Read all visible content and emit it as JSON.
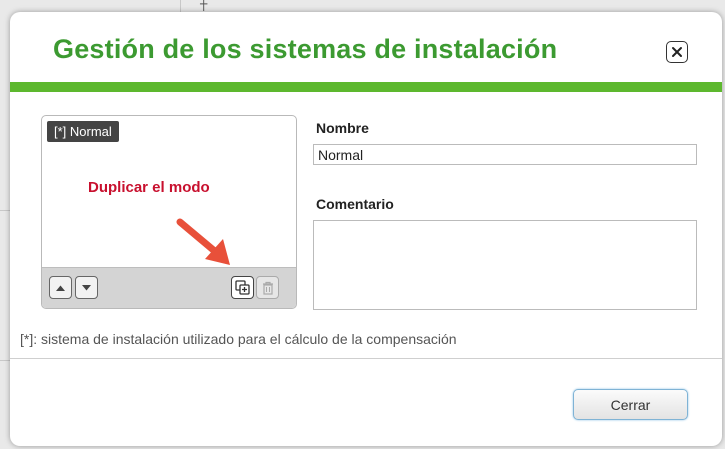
{
  "dialog": {
    "title": "Gestión de los sistemas de instalación",
    "close_icon": "close-icon",
    "accent_color": "#5db82e",
    "title_color": "#3c9a31"
  },
  "list": {
    "selected_item": "[*] Normal",
    "annotation": "Duplicar el modo",
    "annotation_color": "#c8102e",
    "toolbar": {
      "up_icon": "arrow-up-icon",
      "down_icon": "arrow-down-icon",
      "duplicate_icon": "duplicate-icon",
      "delete_icon": "trash-icon"
    }
  },
  "form": {
    "name_label": "Nombre",
    "name_value": "Normal",
    "comment_label": "Comentario",
    "comment_value": ""
  },
  "footnote": "[*]: sistema de instalación utilizado para el cálculo de la compensación",
  "footer": {
    "close_label": "Cerrar"
  }
}
